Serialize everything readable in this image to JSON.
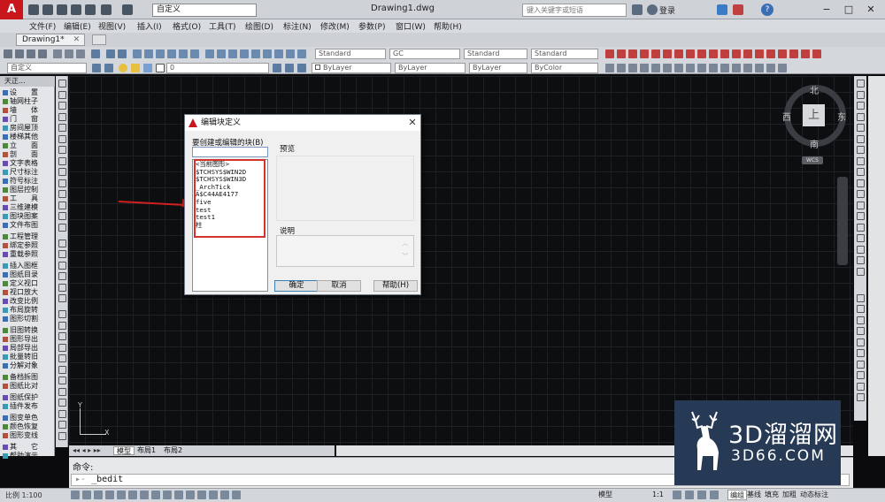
{
  "titlebar": {
    "workspace": "自定义",
    "doc_title": "Drawing1.dwg",
    "search_placeholder": "键入关键字或短语",
    "login": "登录",
    "help_symbol": "?"
  },
  "menu": [
    "文件(F)",
    "编辑(E)",
    "视图(V)",
    "插入(I)",
    "格式(O)",
    "工具(T)",
    "绘图(D)",
    "标注(N)",
    "修改(M)",
    "参数(P)",
    "窗口(W)",
    "帮助(H)"
  ],
  "tabs": {
    "active": "Drawing1*"
  },
  "toolbar1": {
    "text_style": "Standard",
    "gc": "GC",
    "dim_style": "Standard",
    "table_style": "Standard"
  },
  "toolbar2": {
    "workspace": "自定义",
    "layer": "0",
    "color": "ByLayer",
    "linetype": "ByLayer",
    "lineweight": "ByLayer",
    "plotstyle": "ByColor"
  },
  "palette": {
    "title": "天正...",
    "items": [
      "设　　置",
      "轴网柱子",
      "墙　　体",
      "门　　窗",
      "房间屋顶",
      "楼梯其他",
      "立　　面",
      "剖　　面",
      "文字表格",
      "尺寸标注",
      "符号标注",
      "图层控制",
      "工　　具",
      "三维建模",
      "图块图案",
      "文件布图",
      "工程管理",
      "绑定参照",
      "重载参照",
      "插入图框",
      "图纸目录",
      "定义视口",
      "视口放大",
      "改变比例",
      "布局旋转",
      "图形切割",
      "旧图转换",
      "图形导出",
      "局部导出",
      "批量转旧",
      "分解对象",
      "备档拆图",
      "图纸比对",
      "图纸保护",
      "插件发布",
      "图变单色",
      "颜色恢复",
      "图形变线",
      "其　　它",
      "帮助演示"
    ]
  },
  "viewcube": {
    "north": "北",
    "south": "南",
    "east": "东",
    "west": "西",
    "top": "上",
    "wcs": "WCS"
  },
  "ucs": {
    "x": "X",
    "y": "Y"
  },
  "layout_tabs": [
    "模型",
    "布局1",
    "布局2"
  ],
  "command": {
    "label": "命令:",
    "input": "_bedit"
  },
  "statusbar": {
    "scale": "比例 1:100",
    "model": "模型",
    "buttons": [
      "编组",
      "基线",
      "填充",
      "加粗",
      "动态标注"
    ],
    "annot_scale": "1:1"
  },
  "dialog": {
    "title": "编辑块定义",
    "block_label": "要创建或编辑的块(B)",
    "block_list": [
      "<当前图形>",
      "$TCHSYS$WIN2D",
      "$TCHSYS$WIN3D",
      "_ArchTick",
      "A$C44AE4177",
      "five",
      "test",
      "test1",
      "柱"
    ],
    "preview_label": "预览",
    "description_label": "说明",
    "ok": "确定",
    "cancel": "取消",
    "help": "帮助(H)",
    "close_symbol": "✕"
  },
  "watermark": {
    "title": "3D溜溜网",
    "url": "3D66.COM"
  },
  "colors": {
    "app_red": "#c9161d",
    "canvas": "#0d0e10",
    "highlight_red": "#d4322c",
    "watermark_bg": "#273a55"
  }
}
